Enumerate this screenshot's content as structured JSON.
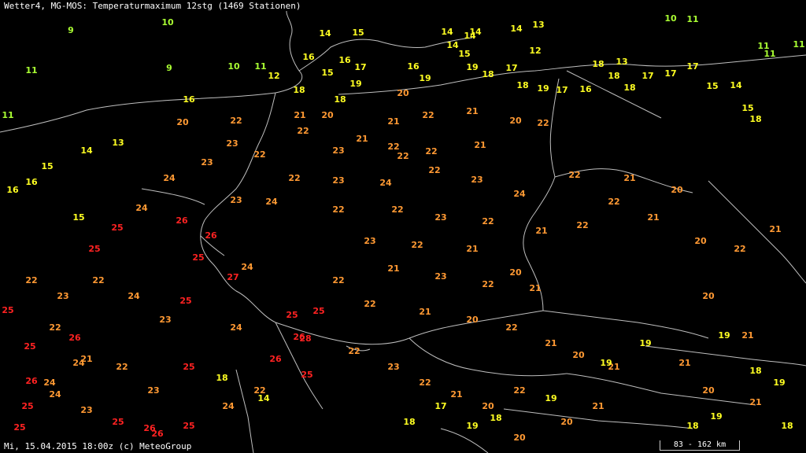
{
  "header": {
    "title": "Wetter4, MG-MOS: Temperaturmaximum 12stg (1469 Stationen)"
  },
  "footer": {
    "timestamp": "Mi, 15.04.2015 18:00z (c) MeteoGroup"
  },
  "scale": {
    "label": "83 - 162 km"
  },
  "colors": {
    "background": "#000000",
    "borders": "#bfbfbf",
    "temp_9_11": "#aaff33",
    "temp_10_19": "#ffff22",
    "temp_20_24": "#ff9933",
    "temp_25_plus": "#ff2222"
  },
  "stations": [
    {
      "v": 9
    },
    {
      "v": 10
    },
    {
      "v": 10
    },
    {
      "v": 9
    },
    {
      "v": 10
    },
    {
      "v": 11
    },
    {
      "v": 11
    },
    {
      "v": 11
    },
    {
      "v": 14
    },
    {
      "v": 15
    },
    {
      "v": 13
    },
    {
      "v": 14
    },
    {
      "v": 11
    },
    {
      "v": 11
    },
    {
      "v": 11
    },
    {
      "v": 16
    },
    {
      "v": 15
    },
    {
      "v": 14
    },
    {
      "v": 17
    },
    {
      "v": 14
    },
    {
      "v": 12
    },
    {
      "v": 15
    },
    {
      "v": 14
    },
    {
      "v": 14
    },
    {
      "v": 16
    },
    {
      "v": 11
    },
    {
      "v": 16
    },
    {
      "v": 18
    },
    {
      "v": 18
    },
    {
      "v": 20
    },
    {
      "v": 19
    },
    {
      "v": 17
    },
    {
      "v": 18
    },
    {
      "v": 19
    },
    {
      "v": 15
    },
    {
      "v": 14
    },
    {
      "v": 15
    },
    {
      "v": 18
    },
    {
      "v": 17
    },
    {
      "v": 16
    },
    {
      "v": 19
    },
    {
      "v": 19
    },
    {
      "v": 18
    },
    {
      "v": 12
    },
    {
      "v": 13
    },
    {
      "v": 17
    },
    {
      "v": 18
    },
    {
      "v": 18
    },
    {
      "v": 17
    },
    {
      "v": 16
    },
    {
      "v": 18
    },
    {
      "v": 17
    },
    {
      "v": 20
    },
    {
      "v": 21
    },
    {
      "v": 22
    },
    {
      "v": 20
    },
    {
      "v": 21
    },
    {
      "v": 22
    },
    {
      "v": 21
    },
    {
      "v": 20
    },
    {
      "v": 22
    },
    {
      "v": 23
    },
    {
      "v": 22
    },
    {
      "v": 22
    },
    {
      "v": 21
    },
    {
      "v": 23
    },
    {
      "v": 22
    },
    {
      "v": 22
    },
    {
      "v": 21
    },
    {
      "v": 22
    },
    {
      "v": 24
    },
    {
      "v": 23
    },
    {
      "v": 22
    },
    {
      "v": 23
    },
    {
      "v": 24
    },
    {
      "v": 22
    },
    {
      "v": 23
    },
    {
      "v": 24
    },
    {
      "v": 22
    },
    {
      "v": 25
    },
    {
      "v": 26
    },
    {
      "v": 24
    },
    {
      "v": 25
    },
    {
      "v": 26
    },
    {
      "v": 23
    },
    {
      "v": 24
    },
    {
      "v": 22
    },
    {
      "v": 25
    },
    {
      "v": 22
    },
    {
      "v": 23
    },
    {
      "v": 22
    },
    {
      "v": 21
    },
    {
      "v": 22
    },
    {
      "v": 23
    },
    {
      "v": 22
    },
    {
      "v": 21
    },
    {
      "v": 20
    },
    {
      "v": 26
    },
    {
      "v": 25
    },
    {
      "v": 27
    },
    {
      "v": 25
    },
    {
      "v": 26
    },
    {
      "v": 24
    },
    {
      "v": 25
    },
    {
      "v": 28
    },
    {
      "v": 25
    },
    {
      "v": 22
    },
    {
      "v": 21
    },
    {
      "v": 23
    },
    {
      "v": 22
    },
    {
      "v": 21
    },
    {
      "v": 22
    },
    {
      "v": 21
    },
    {
      "v": 20
    },
    {
      "v": 22
    },
    {
      "v": 24
    },
    {
      "v": 25
    },
    {
      "v": 24
    },
    {
      "v": 23
    },
    {
      "v": 25
    },
    {
      "v": 26
    },
    {
      "v": 25
    },
    {
      "v": 24
    },
    {
      "v": 22
    },
    {
      "v": 21
    },
    {
      "v": 20
    },
    {
      "v": 21
    },
    {
      "v": 19
    },
    {
      "v": 21
    },
    {
      "v": 20
    },
    {
      "v": 19
    },
    {
      "v": 18
    },
    {
      "v": 19
    },
    {
      "v": 22
    },
    {
      "v": 23
    },
    {
      "v": 22
    },
    {
      "v": 21
    },
    {
      "v": 20
    },
    {
      "v": 22
    },
    {
      "v": 19
    },
    {
      "v": 20
    },
    {
      "v": 21
    },
    {
      "v": 18
    },
    {
      "v": 17
    },
    {
      "v": 18
    },
    {
      "v": 19
    },
    {
      "v": 20
    },
    {
      "v": 18
    },
    {
      "v": 19
    },
    {
      "v": 21
    },
    {
      "v": 18
    },
    {
      "v": 16
    },
    {
      "v": 15
    },
    {
      "v": 14
    },
    {
      "v": 13
    },
    {
      "v": 15
    },
    {
      "v": 16
    },
    {
      "v": 18
    },
    {
      "v": 14
    },
    {
      "v": 19
    },
    {
      "v": 20
    },
    {
      "v": 21
    },
    {
      "v": 22
    },
    {
      "v": 21
    },
    {
      "v": 20
    },
    {
      "v": 22
    },
    {
      "v": 21
    },
    {
      "v": 20
    },
    {
      "v": 21
    },
    {
      "v": 22
    },
    {
      "v": 23
    },
    {
      "v": 22
    },
    {
      "v": 24
    },
    {
      "v": 23
    },
    {
      "v": 22
    },
    {
      "v": 21
    },
    {
      "v": 22
    },
    {
      "v": 23
    },
    {
      "v": 25
    },
    {
      "v": 26
    },
    {
      "v": 25
    },
    {
      "v": 24
    },
    {
      "v": 26
    },
    {
      "v": 25
    },
    {
      "v": 24
    },
    {
      "v": 26
    },
    {
      "v": 25
    }
  ]
}
